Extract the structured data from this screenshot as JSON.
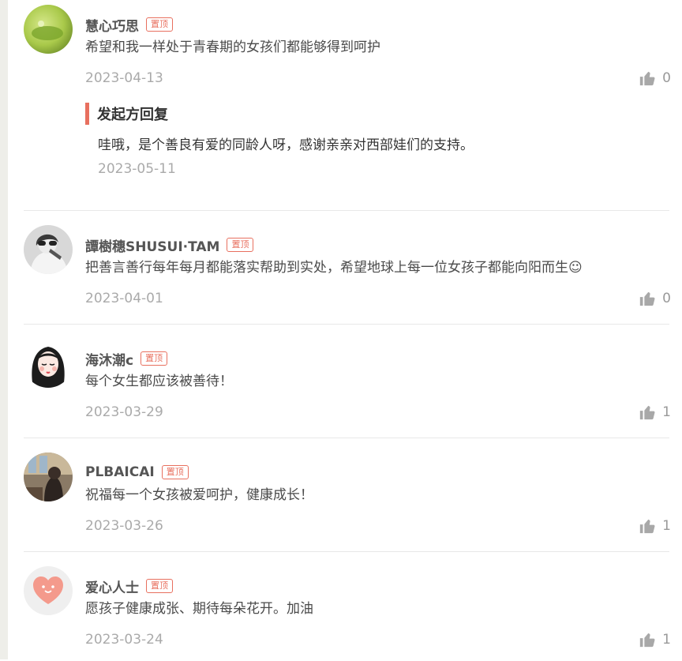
{
  "comments": [
    {
      "name": "慧心巧思",
      "pin_label": "置顶",
      "content": "希望和我一样处于青春期的女孩们都能够得到呵护",
      "date": "2023-04-13",
      "likes": "0",
      "reply": {
        "title": "发起方回复",
        "text": "哇哦，是个善良有爱的同龄人呀，感谢亲亲对西部娃们的支持。",
        "date": "2023-05-11"
      }
    },
    {
      "name": "譚樹穗SHUSUI·TAM",
      "pin_label": "置顶",
      "content": "把善言善行每年每月都能落实帮助到实处，希望地球上每一位女孩子都能向阳而生☺",
      "date": "2023-04-01",
      "likes": "0"
    },
    {
      "name": "海沐潮c",
      "pin_label": "置顶",
      "content": "每个女生都应该被善待！",
      "date": "2023-03-29",
      "likes": "1"
    },
    {
      "name": "PLBAICAI",
      "pin_label": "置顶",
      "content": "祝福每一个女孩被爱呵护，健康成长！",
      "date": "2023-03-26",
      "likes": "1"
    },
    {
      "name": "爱心人士",
      "pin_label": "置顶",
      "content": "愿孩子健康成张、期待每朵花开。加油",
      "date": "2023-03-24",
      "likes": "1"
    }
  ],
  "icons": {
    "like": "thumbs-up-icon"
  },
  "colors": {
    "pin": "#e8705f",
    "reply_bar": "#e8705f",
    "date": "#aaaaaa"
  }
}
